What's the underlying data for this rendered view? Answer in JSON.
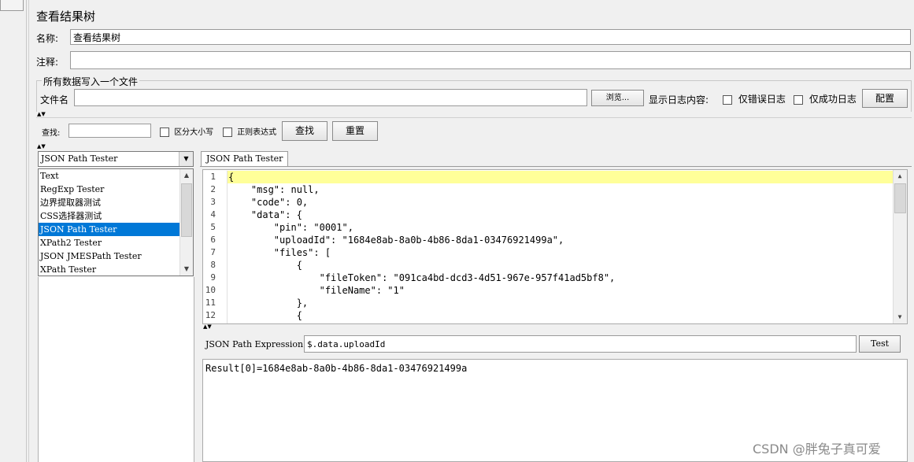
{
  "panel_title": "查看结果树",
  "name": {
    "label": "名称:",
    "value": "查看结果树"
  },
  "comment": {
    "label": "注释:",
    "value": ""
  },
  "file_section": {
    "legend": "所有数据写入一个文件",
    "file_label": "文件名",
    "file_value": "",
    "browse_label": "浏览...",
    "log_label": "显示日志内容:",
    "errors_only": "仅错误日志",
    "success_only": "仅成功日志",
    "config_label": "配置"
  },
  "search": {
    "label": "查找:",
    "value": "",
    "case_label": "区分大小写",
    "regex_label": "正则表达式",
    "find_label": "查找",
    "reset_label": "重置"
  },
  "renderer": {
    "selected": "JSON Path Tester",
    "options": [
      "Text",
      "RegExp Tester",
      "边界提取器测试",
      "CSS选择器测试",
      "JSON Path Tester",
      "XPath2 Tester",
      "JSON JMESPath Tester",
      "XPath Tester"
    ],
    "selected_index": 4
  },
  "tab_label": "JSON Path Tester",
  "code_lines": [
    "{",
    "    \"msg\": null,",
    "    \"code\": 0,",
    "    \"data\": {",
    "        \"pin\": \"0001\",",
    "        \"uploadId\": \"1684e8ab-8a0b-4b86-8da1-03476921499a\",",
    "        \"files\": [",
    "            {",
    "                \"fileToken\": \"091ca4bd-dcd3-4d51-967e-957f41ad5bf8\",",
    "                \"fileName\": \"1\"",
    "            },",
    "            {"
  ],
  "line_numbers": [
    "1",
    "2",
    "3",
    "4",
    "5",
    "6",
    "7",
    "8",
    "9",
    "10",
    "11",
    "12"
  ],
  "expression": {
    "label": "JSON Path Expression",
    "value": "$.data.uploadId",
    "test_label": "Test"
  },
  "result": "Result[0]=1684e8ab-8a0b-4b86-8da1-03476921499a",
  "watermark": "CSDN @胖兔子真可爱"
}
